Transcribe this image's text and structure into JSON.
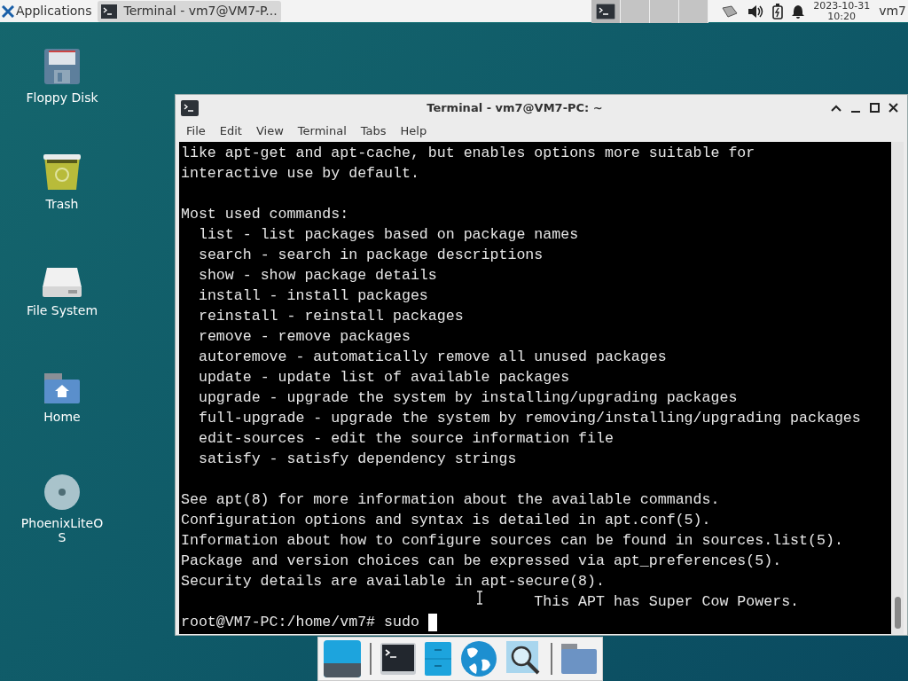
{
  "panel": {
    "applications": "Applications",
    "tasks": [
      {
        "title": "Terminal - vm7@VM7-P...",
        "selected": true
      }
    ],
    "workspaces": [
      {
        "selected": true
      },
      {
        "selected": false
      },
      {
        "selected": false
      },
      {
        "selected": false
      }
    ],
    "date": "2023-10-31",
    "time": "10:20",
    "user": "vm7"
  },
  "desktop_icons": [
    {
      "label": "Floppy Disk",
      "kind": "floppy"
    },
    {
      "label": "Trash",
      "kind": "trash"
    },
    {
      "label": "File System",
      "kind": "drive"
    },
    {
      "label": "Home",
      "kind": "home"
    },
    {
      "label": "PhoenixLiteOS",
      "kind": "disc"
    }
  ],
  "window": {
    "title": "Terminal - vm7@VM7-PC: ~",
    "menu": [
      "File",
      "Edit",
      "View",
      "Terminal",
      "Tabs",
      "Help"
    ],
    "blocks": [
      [
        "like apt-get and apt-cache, but enables options more suitable for",
        "interactive use by default."
      ],
      [
        "Most used commands:",
        "  list - list packages based on package names",
        "  search - search in package descriptions",
        "  show - show package details",
        "  install - install packages",
        "  reinstall - reinstall packages",
        "  remove - remove packages",
        "  autoremove - automatically remove all unused packages",
        "  update - update list of available packages",
        "  upgrade - upgrade the system by installing/upgrading packages",
        "  full-upgrade - upgrade the system by removing/installing/upgrading packages",
        "  edit-sources - edit the source information file",
        "  satisfy - satisfy dependency strings"
      ],
      [
        "See apt(8) for more information about the available commands.",
        "Configuration options and syntax is detailed in apt.conf(5).",
        "Information about how to configure sources can be found in sources.list(5).",
        "Package and version choices can be expressed via apt_preferences(5).",
        "Security details are available in apt-secure(8).",
        "                                        This APT has Super Cow Powers."
      ]
    ],
    "prompt": "root@VM7-PC:/home/vm7# sudo "
  },
  "dock": [
    {
      "kind": "desktop"
    },
    {
      "kind": "terminal"
    },
    {
      "kind": "files"
    },
    {
      "kind": "web"
    },
    {
      "kind": "search"
    },
    {
      "kind": "folder"
    }
  ]
}
